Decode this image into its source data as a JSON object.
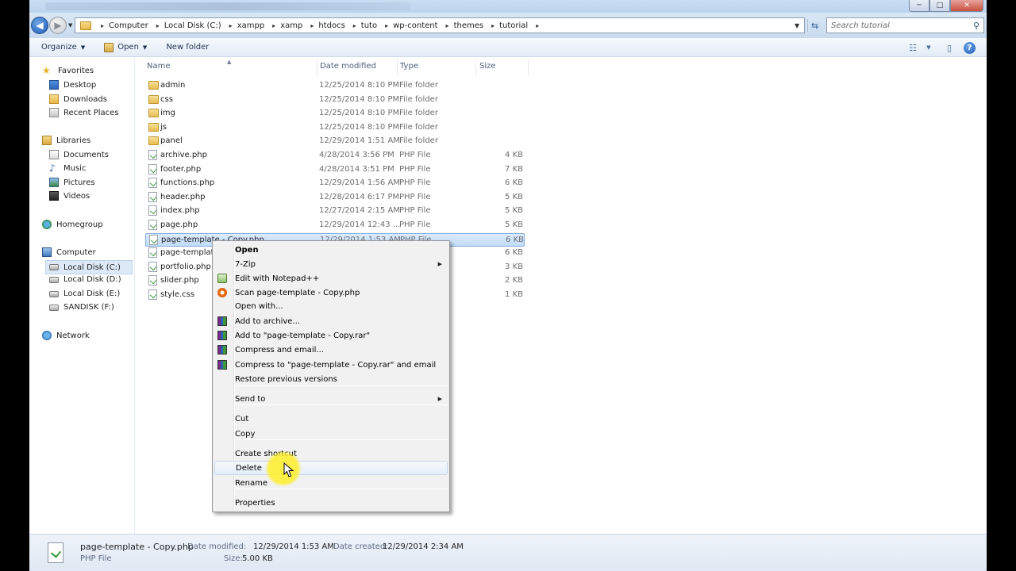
{
  "window": {
    "minimize_glyph": "─",
    "maximize_glyph": "□",
    "close_glyph": "✕"
  },
  "address": {
    "breadcrumbs": [
      "Computer",
      "Local Disk (C:)",
      "xampp",
      "xamp",
      "htdocs",
      "tuto",
      "wp-content",
      "themes",
      "tutorial"
    ],
    "search_placeholder": "Search tutorial"
  },
  "toolbar": {
    "organize_label": "Organize",
    "open_label": "Open",
    "new_folder_label": "New folder"
  },
  "nav": {
    "favorites": {
      "label": "Favorites",
      "items": [
        "Desktop",
        "Downloads",
        "Recent Places"
      ]
    },
    "libraries": {
      "label": "Libraries",
      "items": [
        "Documents",
        "Music",
        "Pictures",
        "Videos"
      ]
    },
    "homegroup": "Homegroup",
    "computer": {
      "label": "Computer",
      "items": [
        "Local Disk (C:)",
        "Local Disk (D:)",
        "Local Disk (E:)",
        "SANDISK (F:)"
      ],
      "selected_index": 0
    },
    "network": "Network"
  },
  "columns": {
    "name": "Name",
    "date": "Date modified",
    "type": "Type",
    "size": "Size"
  },
  "files": [
    {
      "name": "admin",
      "date": "12/25/2014 8:10 PM",
      "type": "File folder",
      "size": "",
      "kind": "folder"
    },
    {
      "name": "css",
      "date": "12/25/2014 8:10 PM",
      "type": "File folder",
      "size": "",
      "kind": "folder"
    },
    {
      "name": "img",
      "date": "12/25/2014 8:10 PM",
      "type": "File folder",
      "size": "",
      "kind": "folder"
    },
    {
      "name": "js",
      "date": "12/25/2014 8:10 PM",
      "type": "File folder",
      "size": "",
      "kind": "folder"
    },
    {
      "name": "panel",
      "date": "12/29/2014 1:51 AM",
      "type": "File folder",
      "size": "",
      "kind": "folder"
    },
    {
      "name": "archive.php",
      "date": "4/28/2014 3:56 PM",
      "type": "PHP File",
      "size": "4 KB",
      "kind": "file"
    },
    {
      "name": "footer.php",
      "date": "4/28/2014 3:51 PM",
      "type": "PHP File",
      "size": "7 KB",
      "kind": "file"
    },
    {
      "name": "functions.php",
      "date": "12/29/2014 1:56 AM",
      "type": "PHP File",
      "size": "6 KB",
      "kind": "file"
    },
    {
      "name": "header.php",
      "date": "12/28/2014 6:17 PM",
      "type": "PHP File",
      "size": "5 KB",
      "kind": "file"
    },
    {
      "name": "index.php",
      "date": "12/27/2014 2:15 AM",
      "type": "PHP File",
      "size": "5 KB",
      "kind": "file"
    },
    {
      "name": "page.php",
      "date": "12/29/2014 12:43 ...",
      "type": "PHP File",
      "size": "5 KB",
      "kind": "file"
    },
    {
      "name": "page-template - Copy.php",
      "date": "12/29/2014 1:53 AM",
      "type": "PHP File",
      "size": "6 KB",
      "kind": "file",
      "selected": true
    },
    {
      "name": "page-template.php",
      "date": "",
      "type": "",
      "size": "6 KB",
      "kind": "file"
    },
    {
      "name": "portfolio.php",
      "date": "",
      "type": "",
      "size": "3 KB",
      "kind": "file"
    },
    {
      "name": "slider.php",
      "date": "",
      "type": "",
      "size": "2 KB",
      "kind": "file"
    },
    {
      "name": "style.css",
      "date": "",
      "type": "le S...",
      "size": "1 KB",
      "kind": "file"
    }
  ],
  "context_menu": {
    "items": [
      {
        "label": "Open",
        "bold": true
      },
      {
        "label": "7-Zip",
        "submenu": true
      },
      {
        "label": "Edit with Notepad++",
        "icon": "notepad-plus-plus-icon"
      },
      {
        "label": "Scan page-template - Copy.php",
        "icon": "avast-icon"
      },
      {
        "label": "Open with..."
      },
      {
        "label": "Add to archive...",
        "icon": "winrar-icon"
      },
      {
        "label": "Add to \"page-template - Copy.rar\"",
        "icon": "winrar-icon"
      },
      {
        "label": "Compress and email...",
        "icon": "winrar-icon"
      },
      {
        "label": "Compress to \"page-template - Copy.rar\" and email",
        "icon": "winrar-icon"
      },
      {
        "label": "Restore previous versions"
      },
      {
        "label": "Send to",
        "submenu": true
      },
      {
        "label": "Cut"
      },
      {
        "label": "Copy"
      },
      {
        "label": "Create shortcut"
      },
      {
        "label": "Delete",
        "hovered": true
      },
      {
        "label": "Rename"
      },
      {
        "label": "Properties"
      }
    ]
  },
  "details": {
    "filename": "page-template - Copy.php",
    "filetype": "PHP File",
    "date_modified_label": "Date modified:",
    "date_modified": "12/29/2014 1:53 AM",
    "date_created_label": "Date created:",
    "date_created": "12/29/2014 2:34 AM",
    "size_label": "Size:",
    "size": "5.00 KB"
  }
}
